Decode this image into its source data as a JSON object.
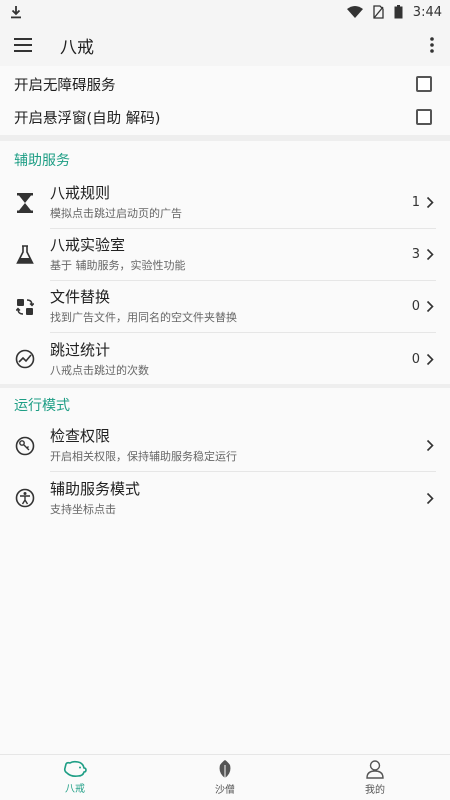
{
  "status_bar": {
    "time": "3:44"
  },
  "app_bar": {
    "title": "八戒"
  },
  "toggles": [
    {
      "label": "开启无障碍服务",
      "checked": false
    },
    {
      "label": "开启悬浮窗(自助 解码)",
      "checked": false
    }
  ],
  "sections": [
    {
      "header": "辅助服务",
      "items": [
        {
          "title": "八戒规则",
          "subtitle": "模拟点击跳过启动页的广告",
          "count": "1",
          "icon": "hourglass-icon"
        },
        {
          "title": "八戒实验室",
          "subtitle": "基于 辅助服务，实验性功能",
          "count": "3",
          "icon": "flask-icon"
        },
        {
          "title": "文件替换",
          "subtitle": "找到广告文件，用同名的空文件夹替换",
          "count": "0",
          "icon": "swap-files-icon"
        },
        {
          "title": "跳过统计",
          "subtitle": "八戒点击跳过的次数",
          "count": "0",
          "icon": "stats-icon"
        }
      ]
    },
    {
      "header": "运行模式",
      "items": [
        {
          "title": "检查权限",
          "subtitle": "开启相关权限，保持辅助服务稳定运行",
          "icon": "permission-icon"
        },
        {
          "title": "辅助服务模式",
          "subtitle": "支持坐标点击",
          "icon": "accessibility-icon"
        }
      ]
    }
  ],
  "bottom_nav": [
    {
      "label": "八戒",
      "icon": "pig-icon",
      "active": true
    },
    {
      "label": "沙僧",
      "icon": "leaf-icon",
      "active": false
    },
    {
      "label": "我的",
      "icon": "user-icon",
      "active": false
    }
  ],
  "colors": {
    "accent": "#1e9e85",
    "background": "#fafafa",
    "divider": "#e6e6e6"
  }
}
